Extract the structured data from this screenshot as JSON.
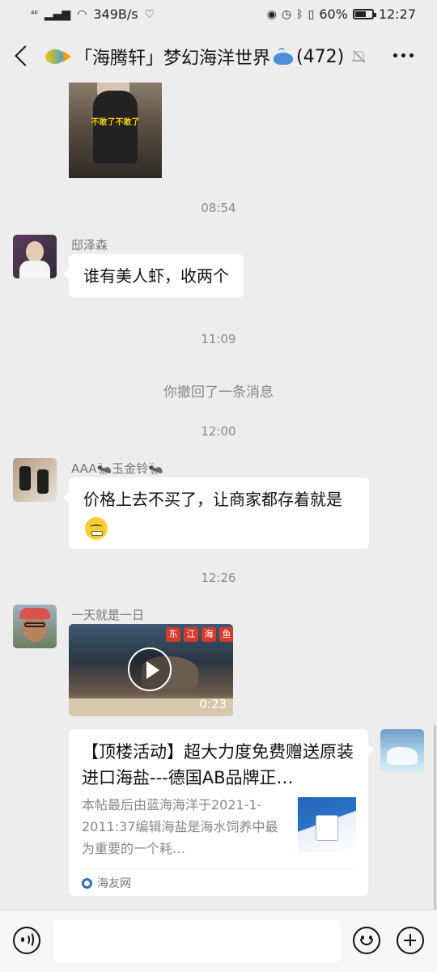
{
  "status_bar": {
    "network": "⁴⁶",
    "speed": "349B/s",
    "battery": "60%",
    "time": "12:27",
    "battery_level": 0.6
  },
  "header": {
    "title": "「海腾轩」梦幻海洋世界",
    "member_count": "(472)"
  },
  "messages": {
    "photo_caption": "不敢了不敢了",
    "time_1": "08:54",
    "msg1": {
      "sender": "邸泽森",
      "text": "谁有美人虾，收两个"
    },
    "time_2": "11:09",
    "system_recall": "你撤回了一条消息",
    "time_3": "12:00",
    "msg2": {
      "sender": "AAA🐜玉金铃🐜",
      "text": "价格上去不买了，让商家都存着就是"
    },
    "time_4": "12:26",
    "msg3": {
      "sender": "一天就是一日",
      "video_tags": [
        "东",
        "江",
        "海",
        "鱼"
      ],
      "video_duration": "0:23"
    },
    "link_card": {
      "title": "【顶楼活动】超大力度免费赠送原装进口海盐---德国AB品牌正…",
      "description": "本帖最后由蓝海海洋于2021-1-2011:37编辑海盐是海水饲养中最为重要的一个耗…",
      "source": "海友网"
    }
  },
  "input_bar": {
    "placeholder": ""
  }
}
